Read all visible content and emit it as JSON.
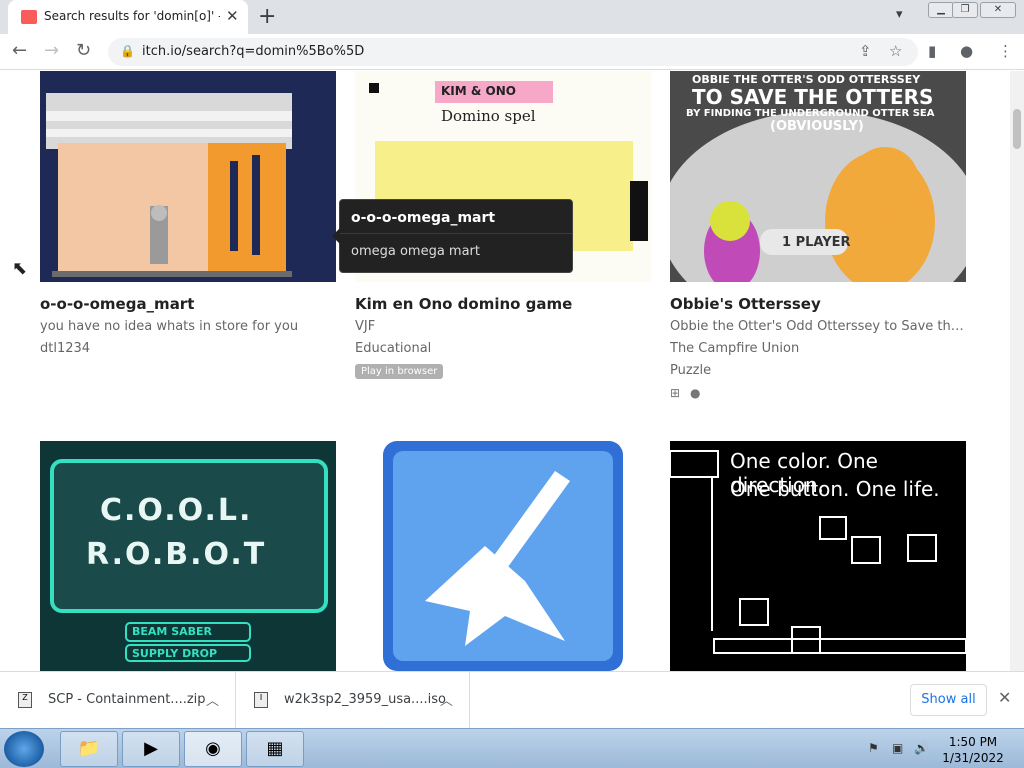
{
  "browser": {
    "tab_title": "Search results for 'domin[o]' - itch.io",
    "tab_close": "✕",
    "new_tab": "+",
    "url": "itch.io/search?q=domin%5Bo%5D",
    "back_icon": "arrow-left-icon",
    "forward_icon": "arrow-right-icon",
    "reload_icon": "reload-icon"
  },
  "tooltip": {
    "title": "o-o-o-omega_mart",
    "subtitle": "omega omega mart"
  },
  "games": [
    {
      "title": "o-o-o-omega_mart",
      "line1": "you have no idea whats in store for you",
      "line2": "dtl1234",
      "line3": "",
      "badge": ""
    },
    {
      "title": "Kim en Ono domino game",
      "line1": "VJF",
      "line2": "Educational",
      "line3": "",
      "badge": "Play in browser",
      "thumb_text_1": "KIM & ONO",
      "thumb_text_2": "Domino spel"
    },
    {
      "title": "Obbie's Otterssey",
      "line1": "Obbie the Otter's Odd Otterssey to Save the O...",
      "line2": "The Campfire Union",
      "line3": "Puzzle",
      "badge": "",
      "thumb_text_1": "OBBIE THE OTTER'S ODD OTTERSSEY",
      "thumb_text_2": "TO SAVE THE OTTERS",
      "thumb_text_3": "BY FINDING THE UNDERGROUND OTTER SEA",
      "thumb_text_4": "(OBVIOUSLY)",
      "thumb_text_5": "1 PLAYER"
    }
  ],
  "row2": [
    {
      "thumb_text_1": "C.O.O.L.",
      "thumb_text_2": "R.O.B.O.T",
      "thumb_text_3": "BEAM SABER",
      "thumb_text_4": "SUPPLY DROP"
    },
    {},
    {
      "thumb_text_1": "One color. One direction.",
      "thumb_text_2": "One button. One life."
    }
  ],
  "downloads": {
    "items": [
      {
        "name": "SCP - Containment....zip"
      },
      {
        "name": "w2k3sp2_3959_usa....iso"
      }
    ],
    "show_all": "Show all"
  },
  "taskbar": {
    "time": "1:50 PM",
    "date": "1/31/2022"
  }
}
